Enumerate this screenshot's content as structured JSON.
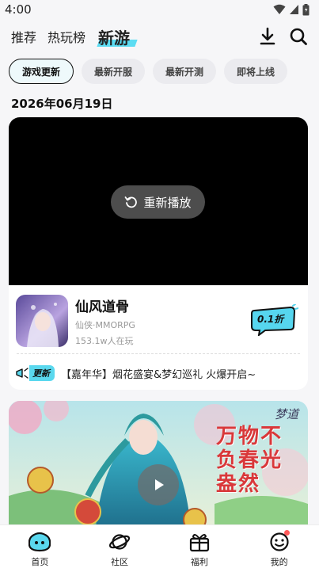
{
  "status_bar": {
    "time": "4:00"
  },
  "top_nav": {
    "tabs": [
      {
        "label": "推荐"
      },
      {
        "label": "热玩榜"
      },
      {
        "label": "新游",
        "active": true
      }
    ],
    "icons": [
      "download-icon",
      "search-icon"
    ]
  },
  "filters": {
    "chips": [
      {
        "label": "游戏更新",
        "active": true
      },
      {
        "label": "最新开服"
      },
      {
        "label": "最新开测"
      },
      {
        "label": "即将上线"
      }
    ]
  },
  "date_heading": "2026年06月19日",
  "game_card": {
    "replay_label": "重新播放",
    "name": "仙风道骨",
    "meta": "仙侠·MMORPG",
    "players": "153.1w人在玩",
    "discount": "0.1折",
    "update_tag": "更新",
    "update_text": "【嘉年华】烟花盛宴&梦幻巡礼 火爆开启~",
    "accent_color": "#5ad8ee"
  },
  "banner": {
    "headline": "万物不负春光盎然",
    "logo_text": "梦道"
  },
  "bottom_nav": {
    "items": [
      {
        "label": "首页",
        "icon": "home-icon",
        "active": true
      },
      {
        "label": "社区",
        "icon": "planet-icon"
      },
      {
        "label": "福利",
        "icon": "gift-icon"
      },
      {
        "label": "我的",
        "icon": "profile-icon",
        "dot": true
      }
    ]
  }
}
